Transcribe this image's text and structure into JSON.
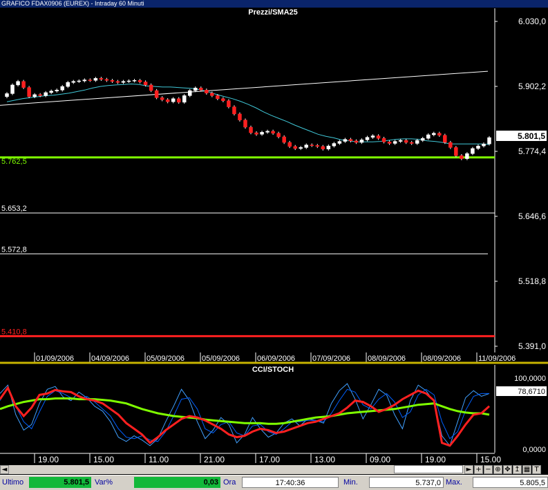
{
  "window": {
    "title": "GRAFICO FDAX0906 (EUREX) - Intraday 60 Minuti"
  },
  "price_panel": {
    "title": "Prezzi/SMA25",
    "y_ticks": [
      "6.030,0",
      "5.902,2",
      "5.774,4",
      "5.646,6",
      "5.518,8",
      "5.391,0"
    ],
    "last_price_label": "5.801,5",
    "levels": [
      {
        "label": "5.762,5",
        "color": "#7fff00"
      },
      {
        "label": "5.653,2",
        "color": "#ffffff"
      },
      {
        "label": "5.572,8",
        "color": "#ffffff"
      },
      {
        "label": "5.410,8",
        "color": "#ff2020"
      }
    ],
    "date_labels": [
      "01/09/2006",
      "04/09/2006",
      "05/09/2006",
      "05/09/2006",
      "06/09/2006",
      "07/09/2006",
      "08/09/2006",
      "08/09/2006",
      "11/09/2006"
    ]
  },
  "indicator_panel": {
    "title": "CCI/STOCH",
    "y_ticks": [
      "100,0000",
      "0,0000"
    ],
    "last_value_label": "78,6710",
    "time_labels": [
      "19.00",
      "15.00",
      "11.00",
      "21.00",
      "17.00",
      "13.00",
      "09.00",
      "19.00",
      "15.00"
    ]
  },
  "colors": {
    "sma": "#40c8d8",
    "up_candle": "#ffffff",
    "down_candle": "#ff2020",
    "separator": "#c8b400"
  },
  "chart_data": [
    {
      "type": "candlestick",
      "title": "Prezzi/SMA25",
      "ylim": [
        5391.0,
        6030.0
      ],
      "y_ticks": [
        6030.0,
        5902.2,
        5774.4,
        5646.6,
        5518.8,
        5391.0
      ],
      "last": 5801.5,
      "horizontal_levels": [
        5762.5,
        5653.2,
        5572.8,
        5410.8
      ],
      "close_series": [
        5888,
        5905,
        5912,
        5900,
        5882,
        5886,
        5884,
        5890,
        5893,
        5895,
        5902,
        5910,
        5912,
        5913,
        5915,
        5914,
        5918,
        5916,
        5914,
        5912,
        5910,
        5912,
        5913,
        5914,
        5911,
        5905,
        5894,
        5880,
        5876,
        5872,
        5878,
        5871,
        5884,
        5894,
        5899,
        5895,
        5889,
        5884,
        5878,
        5874,
        5862,
        5848,
        5836,
        5822,
        5811,
        5808,
        5812,
        5814,
        5810,
        5803,
        5792,
        5784,
        5780,
        5782,
        5787,
        5786,
        5784,
        5779,
        5785,
        5790,
        5794,
        5798,
        5795,
        5792,
        5797,
        5802,
        5805,
        5800,
        5793,
        5790,
        5794,
        5796,
        5792,
        5790,
        5796,
        5800,
        5807,
        5810,
        5806,
        5792,
        5782,
        5766,
        5760,
        5770,
        5780,
        5785,
        5789,
        5801.5
      ],
      "sma_series": [
        5872,
        5875,
        5878,
        5880,
        5882,
        5884,
        5885,
        5887,
        5889,
        5892,
        5895,
        5899,
        5902,
        5904,
        5905,
        5906,
        5907,
        5906,
        5903,
        5902,
        5901,
        5901,
        5900,
        5899,
        5898,
        5895,
        5891,
        5886,
        5882,
        5878,
        5873,
        5867,
        5860,
        5852,
        5845,
        5839,
        5833,
        5826,
        5820,
        5814,
        5808,
        5804,
        5801,
        5797,
        5795,
        5793,
        5793,
        5793,
        5794,
        5796,
        5798,
        5799,
        5799,
        5798,
        5795,
        5794,
        5792,
        5789,
        5789,
        5789,
        5789,
        5789,
        5788
      ],
      "trendline": {
        "start": 5865,
        "end": 5932
      }
    },
    {
      "type": "line",
      "title": "CCI/STOCH",
      "ylim": [
        0,
        100
      ],
      "last": 78.671,
      "series": [
        {
          "color": "#ff2020",
          "values": [
            72,
            88,
            62,
            48,
            60,
            78,
            80,
            85,
            83,
            82,
            76,
            72,
            70,
            66,
            58,
            50,
            38,
            30,
            22,
            10,
            18,
            28,
            36,
            44,
            48,
            46,
            42,
            36,
            30,
            22,
            18,
            20,
            26,
            30,
            28,
            24,
            26,
            30,
            34,
            38,
            40,
            44,
            48,
            52,
            60,
            70,
            68,
            62,
            54,
            58,
            64,
            72,
            78,
            84,
            80,
            70,
            10,
            6,
            20,
            36,
            50,
            52,
            62
          ]
        },
        {
          "color": "#40a0ff",
          "values": [
            80,
            92,
            50,
            28,
            36,
            66,
            86,
            90,
            75,
            70,
            82,
            74,
            62,
            55,
            40,
            18,
            12,
            20,
            14,
            6,
            16,
            40,
            62,
            86,
            70,
            40,
            16,
            28,
            46,
            36,
            10,
            22,
            46,
            30,
            18,
            24,
            38,
            44,
            34,
            44,
            42,
            38,
            66,
            84,
            94,
            72,
            44,
            64,
            86,
            78,
            50,
            30,
            70,
            92,
            84,
            68,
            20,
            6,
            40,
            74,
            84,
            76,
            80
          ]
        },
        {
          "color": "#0060ff",
          "values": [
            70,
            88,
            62,
            40,
            30,
            54,
            76,
            84,
            80,
            74,
            72,
            76,
            68,
            58,
            48,
            30,
            18,
            16,
            20,
            14,
            12,
            26,
            48,
            72,
            74,
            58,
            30,
            24,
            36,
            40,
            24,
            20,
            34,
            36,
            26,
            22,
            30,
            40,
            40,
            42,
            42,
            40,
            52,
            70,
            86,
            82,
            64,
            58,
            72,
            80,
            68,
            46,
            54,
            78,
            86,
            78,
            40,
            16,
            26,
            56,
            76,
            80,
            80
          ]
        },
        {
          "color": "#7fff00",
          "values": [
            58,
            62,
            65,
            68,
            70,
            72,
            72,
            73,
            73,
            73,
            72,
            72,
            72,
            71,
            70,
            68,
            66,
            62,
            58,
            55,
            52,
            50,
            48,
            47,
            46,
            45,
            43,
            42,
            41,
            40,
            39,
            38,
            38,
            38,
            37,
            37,
            38,
            40,
            42,
            44,
            46,
            47,
            48,
            50,
            52,
            53,
            54,
            55,
            56,
            57,
            58,
            60,
            62,
            64,
            65,
            66,
            62,
            58,
            55,
            53,
            52,
            52,
            50
          ]
        }
      ]
    }
  ],
  "scrollbar": {
    "left_arrow": "◄",
    "right_arrow": "►"
  },
  "toolbar_icons": [
    "+",
    "−",
    "⊕",
    "✥",
    "↥",
    "▦",
    "T"
  ],
  "bottom_bar": {
    "ultimo_label": "Ultimo",
    "ultimo_value": "5.801,5",
    "var_label": "Var%",
    "var_value": "0,03",
    "ora_label": "Ora",
    "ora_value": "17:40:36",
    "min_label": "Min.",
    "min_value": "5.737,0",
    "max_label": "Max.",
    "max_value": "5.805,5"
  }
}
